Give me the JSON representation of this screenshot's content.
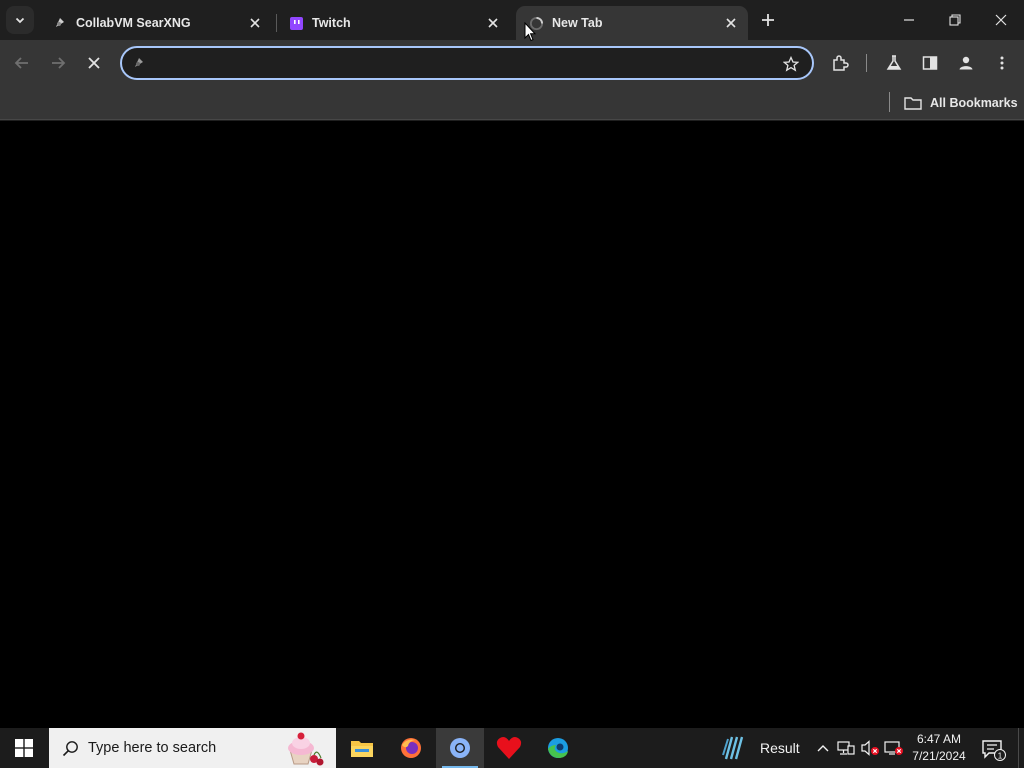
{
  "browser": {
    "tabs": [
      {
        "title": "CollabVM SearXNG",
        "favicon": "searxng-icon",
        "active": false
      },
      {
        "title": "Twitch",
        "favicon": "twitch-icon",
        "active": false
      },
      {
        "title": "New Tab",
        "favicon": "loading-spinner-icon",
        "active": true
      }
    ],
    "omnibox": {
      "value": "",
      "placeholder": ""
    },
    "bookmarks_bar": {
      "all_bookmarks_label": "All Bookmarks"
    },
    "colors": {
      "chrome_bg": "#1f1f1f",
      "toolbar_bg": "#363636",
      "focus_ring": "#a8c7fa"
    }
  },
  "taskbar": {
    "search_placeholder": "Type here to search",
    "pinned_apps": [
      {
        "name": "file-explorer-icon"
      },
      {
        "name": "firefox-icon"
      },
      {
        "name": "chrome-icon",
        "active": true
      },
      {
        "name": "heart-app-icon"
      },
      {
        "name": "edge-icon"
      }
    ],
    "weather_label": "Result",
    "clock": {
      "time": "6:47 AM",
      "date": "7/21/2024"
    },
    "notification_count": "1"
  }
}
